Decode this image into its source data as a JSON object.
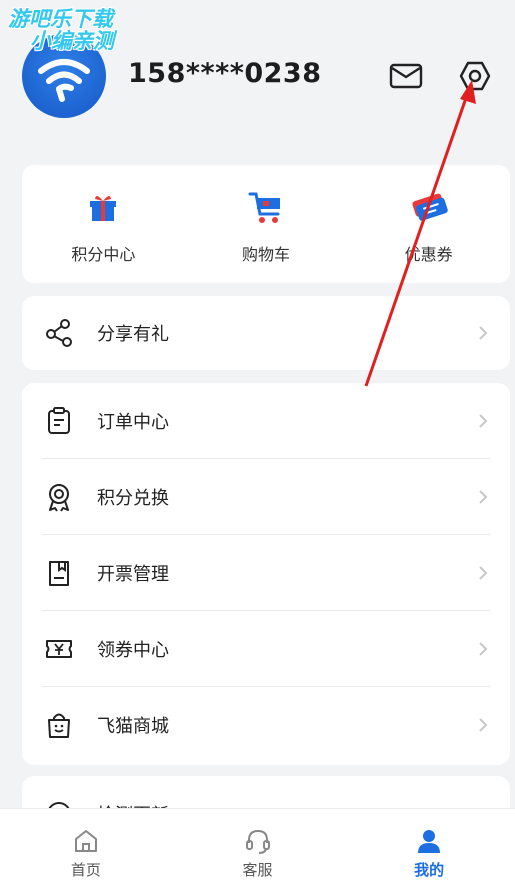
{
  "watermark": {
    "line1": "游吧乐下载",
    "line2": "小编亲测"
  },
  "profile": {
    "phone": "158****0238"
  },
  "quick_actions": [
    {
      "label": "积分中心",
      "icon": "gift-icon"
    },
    {
      "label": "购物车",
      "icon": "cart-icon"
    },
    {
      "label": "优惠券",
      "icon": "coupon-icon"
    }
  ],
  "share": {
    "label": "分享有礼"
  },
  "menu": [
    {
      "label": "订单中心",
      "icon": "order-icon"
    },
    {
      "label": "积分兑换",
      "icon": "badge-icon"
    },
    {
      "label": "开票管理",
      "icon": "invoice-icon"
    },
    {
      "label": "领券中心",
      "icon": "ticket-icon"
    },
    {
      "label": "飞猫商城",
      "icon": "shopping-bag-icon"
    }
  ],
  "update": {
    "label": "检测更新"
  },
  "tabs": [
    {
      "label": "首页",
      "icon": "home-icon"
    },
    {
      "label": "客服",
      "icon": "headset-icon"
    },
    {
      "label": "我的",
      "icon": "user-icon",
      "active": true
    }
  ],
  "colors": {
    "accent": "#1d6ee0",
    "annotation": "#e02020",
    "watermark": "#33c8ee"
  }
}
